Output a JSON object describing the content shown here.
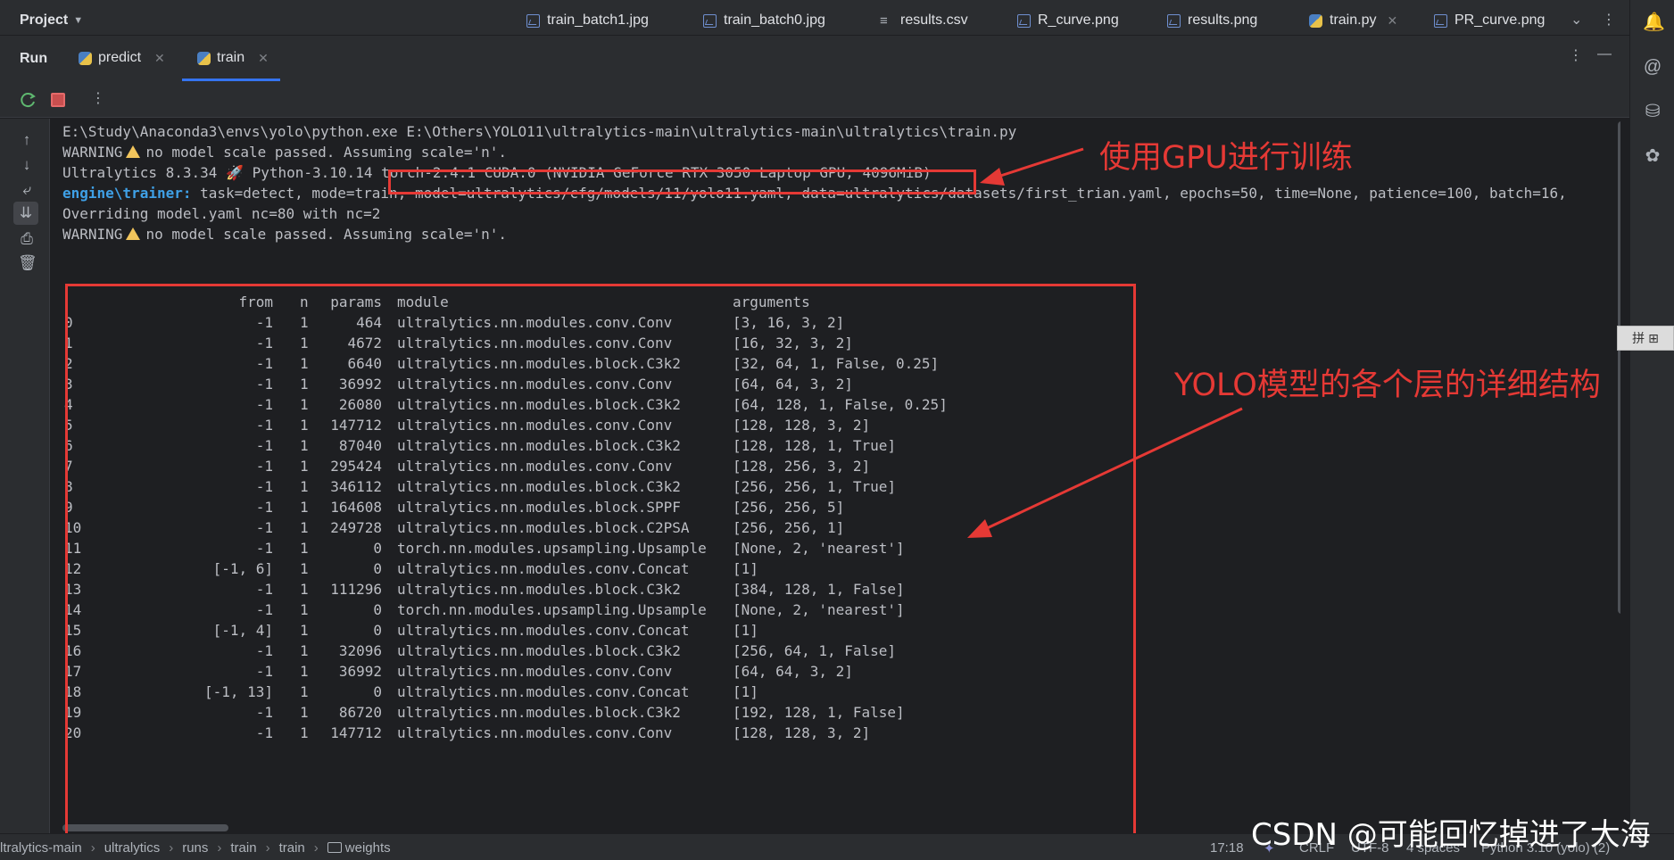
{
  "topbar": {
    "project": "Project",
    "tabs": [
      {
        "label": "train_batch1.jpg",
        "icon": "image-icon"
      },
      {
        "label": "train_batch0.jpg",
        "icon": "image-icon"
      },
      {
        "label": "results.csv",
        "icon": "csv-icon"
      },
      {
        "label": "R_curve.png",
        "icon": "image-icon"
      },
      {
        "label": "results.png",
        "icon": "image-icon"
      },
      {
        "label": "train.py",
        "icon": "python-icon",
        "active": true
      },
      {
        "label": "PR_curve.png",
        "icon": "image-icon"
      }
    ]
  },
  "run": {
    "label": "Run",
    "tabs": [
      {
        "label": "predict"
      },
      {
        "label": "train",
        "active": true
      }
    ]
  },
  "console": {
    "lines": [
      "E:\\Study\\Anaconda3\\envs\\yolo\\python.exe E:\\Others\\YOLO11\\ultralytics-main\\ultralytics-main\\ultralytics\\train.py",
      "no model scale passed. Assuming scale='n'.",
      "Overriding model.yaml nc=80 with nc=2",
      "no model scale passed. Assuming scale='n'."
    ],
    "warning_word": "WARNING",
    "ultralytics_prefix": "Ultralytics 8.3.34",
    "rocket": "🚀",
    "python_version": "Python-3.10.14",
    "torch_info": "torch-2.4.1 CUDA:0 (NVIDIA GeForce RTX 3050 Laptop GPU, 4096MiB)",
    "engine_label": "engine\\trainer:",
    "engine_args": " task=detect, mode=train, model=ultralytics/cfg/models/11/yolo11.yaml, data=ultralytics/datasets/first_trian.yaml, epochs=50, time=None, patience=100, batch=16,"
  },
  "table": {
    "headers": {
      "from": "from",
      "n": "n",
      "params": "params",
      "module": "module",
      "arguments": "arguments"
    },
    "rows": [
      {
        "idx": "0",
        "from": "-1",
        "n": "1",
        "params": "464",
        "module": "ultralytics.nn.modules.conv.Conv",
        "args": "[3, 16, 3, 2]"
      },
      {
        "idx": "1",
        "from": "-1",
        "n": "1",
        "params": "4672",
        "module": "ultralytics.nn.modules.conv.Conv",
        "args": "[16, 32, 3, 2]"
      },
      {
        "idx": "2",
        "from": "-1",
        "n": "1",
        "params": "6640",
        "module": "ultralytics.nn.modules.block.C3k2",
        "args": "[32, 64, 1, False, 0.25]"
      },
      {
        "idx": "3",
        "from": "-1",
        "n": "1",
        "params": "36992",
        "module": "ultralytics.nn.modules.conv.Conv",
        "args": "[64, 64, 3, 2]"
      },
      {
        "idx": "4",
        "from": "-1",
        "n": "1",
        "params": "26080",
        "module": "ultralytics.nn.modules.block.C3k2",
        "args": "[64, 128, 1, False, 0.25]"
      },
      {
        "idx": "5",
        "from": "-1",
        "n": "1",
        "params": "147712",
        "module": "ultralytics.nn.modules.conv.Conv",
        "args": "[128, 128, 3, 2]"
      },
      {
        "idx": "6",
        "from": "-1",
        "n": "1",
        "params": "87040",
        "module": "ultralytics.nn.modules.block.C3k2",
        "args": "[128, 128, 1, True]"
      },
      {
        "idx": "7",
        "from": "-1",
        "n": "1",
        "params": "295424",
        "module": "ultralytics.nn.modules.conv.Conv",
        "args": "[128, 256, 3, 2]"
      },
      {
        "idx": "8",
        "from": "-1",
        "n": "1",
        "params": "346112",
        "module": "ultralytics.nn.modules.block.C3k2",
        "args": "[256, 256, 1, True]"
      },
      {
        "idx": "9",
        "from": "-1",
        "n": "1",
        "params": "164608",
        "module": "ultralytics.nn.modules.block.SPPF",
        "args": "[256, 256, 5]"
      },
      {
        "idx": "10",
        "from": "-1",
        "n": "1",
        "params": "249728",
        "module": "ultralytics.nn.modules.block.C2PSA",
        "args": "[256, 256, 1]"
      },
      {
        "idx": "11",
        "from": "-1",
        "n": "1",
        "params": "0",
        "module": "torch.nn.modules.upsampling.Upsample",
        "args": "[None, 2, 'nearest']"
      },
      {
        "idx": "12",
        "from": "[-1, 6]",
        "n": "1",
        "params": "0",
        "module": "ultralytics.nn.modules.conv.Concat",
        "args": "[1]"
      },
      {
        "idx": "13",
        "from": "-1",
        "n": "1",
        "params": "111296",
        "module": "ultralytics.nn.modules.block.C3k2",
        "args": "[384, 128, 1, False]"
      },
      {
        "idx": "14",
        "from": "-1",
        "n": "1",
        "params": "0",
        "module": "torch.nn.modules.upsampling.Upsample",
        "args": "[None, 2, 'nearest']"
      },
      {
        "idx": "15",
        "from": "[-1, 4]",
        "n": "1",
        "params": "0",
        "module": "ultralytics.nn.modules.conv.Concat",
        "args": "[1]"
      },
      {
        "idx": "16",
        "from": "-1",
        "n": "1",
        "params": "32096",
        "module": "ultralytics.nn.modules.block.C3k2",
        "args": "[256, 64, 1, False]"
      },
      {
        "idx": "17",
        "from": "-1",
        "n": "1",
        "params": "36992",
        "module": "ultralytics.nn.modules.conv.Conv",
        "args": "[64, 64, 3, 2]"
      },
      {
        "idx": "18",
        "from": "[-1, 13]",
        "n": "1",
        "params": "0",
        "module": "ultralytics.nn.modules.conv.Concat",
        "args": "[1]"
      },
      {
        "idx": "19",
        "from": "-1",
        "n": "1",
        "params": "86720",
        "module": "ultralytics.nn.modules.block.C3k2",
        "args": "[192, 128, 1, False]"
      },
      {
        "idx": "20",
        "from": "-1",
        "n": "1",
        "params": "147712",
        "module": "ultralytics.nn.modules.conv.Conv",
        "args": "[128, 128, 3, 2]"
      }
    ]
  },
  "annotations": {
    "gpu_note": "使用GPU进行训练",
    "structure_note": "YOLO模型的各个层的详细结构",
    "color": "#e53935"
  },
  "ime": {
    "label": "拼"
  },
  "status": {
    "breadcrumb": [
      "ltralytics-main",
      "ultralytics",
      "runs",
      "train",
      "train",
      "weights"
    ],
    "time": "17:18",
    "line_sep": "CRLF",
    "encoding": "UTF-8",
    "indent": "4 spaces",
    "interpreter": "Python 3.10 (yolo) (2)"
  },
  "watermark": "CSDN @可能回忆掉进了大海"
}
